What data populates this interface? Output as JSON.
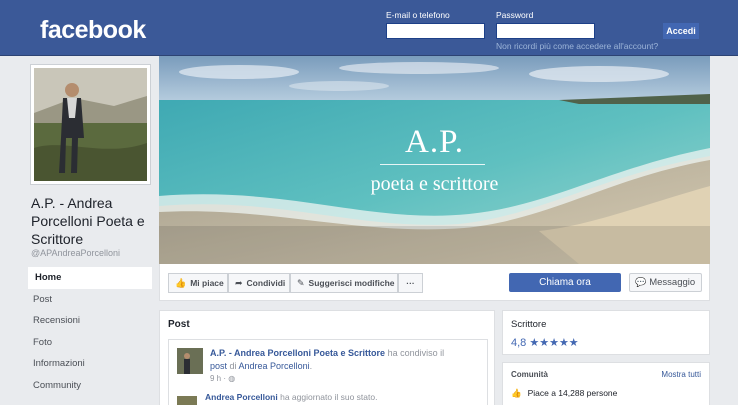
{
  "header": {
    "logo": "facebook",
    "email_label": "E-mail o telefono",
    "password_label": "Password",
    "forgot_link": "Non ricordi più come accedere all'account?",
    "login_button": "Accedi",
    "bar_color": "#3b5998"
  },
  "profile": {
    "name": "A.P. - Andrea Porcelloni Poeta e Scrittore",
    "handle": "@APAndreaPorcelloni"
  },
  "nav": {
    "items": [
      {
        "label": "Home",
        "active": true
      },
      {
        "label": "Post",
        "active": false
      },
      {
        "label": "Recensioni",
        "active": false
      },
      {
        "label": "Foto",
        "active": false
      },
      {
        "label": "Informazioni",
        "active": false
      },
      {
        "label": "Community",
        "active": false
      }
    ]
  },
  "cover": {
    "title": "A.P.",
    "subtitle": "poeta e scrittore"
  },
  "actions": {
    "like": "Mi piace",
    "share": "Condividi",
    "suggest": "Suggerisci modifiche",
    "more": "···",
    "call": "Chiama ora",
    "message": "Messaggio",
    "accent_color": "#4267b2"
  },
  "posts": {
    "heading": "Post",
    "first": {
      "author": "A.P. - Andrea Porcelloni Poeta e Scrittore",
      "text_1": " ha condiviso il ",
      "link_1": "post",
      "text_2": " di ",
      "link_2": "Andrea Porcelloni",
      "time": "9 h"
    },
    "second": {
      "author": "Andrea Porcelloni",
      "text": " ha aggiornato il suo stato."
    }
  },
  "about": {
    "category": "Scrittore",
    "rating": "4,8",
    "stars": 5,
    "community_title": "Comunità",
    "show_all": "Mostra tutti",
    "likes": "Piace a 14,288 persone"
  }
}
